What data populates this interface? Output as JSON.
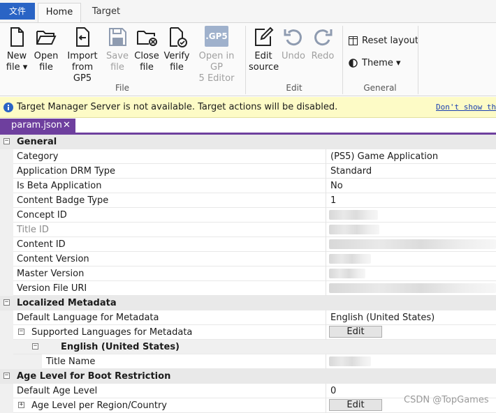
{
  "tabs": {
    "file": "文件",
    "home": "Home",
    "target": "Target"
  },
  "ribbon": {
    "file_group": "File",
    "edit_group": "Edit",
    "general_group": "General",
    "new_label": "New",
    "new_label2": "file ▾",
    "open_label": "Open",
    "open_label2": "file",
    "import_label": "Import",
    "import_label2": "from GP5",
    "save_label": "Save",
    "save_label2": "file",
    "close_label": "Close",
    "close_label2": "file",
    "verify_label": "Verify",
    "verify_label2": "file",
    "opengp_label": "Open in GP",
    "opengp_label2": "5 Editor",
    "gp5_badge": ".GP5",
    "editsrc_label": "Edit",
    "editsrc_label2": "source",
    "undo_label": "Undo",
    "redo_label": "Redo",
    "reset_layout": "Reset layout",
    "theme": "Theme ▾"
  },
  "infobar": {
    "message": "Target Manager Server is not available. Target actions will be disabled.",
    "dont_show": "Don't show this"
  },
  "doc_tab": {
    "name": "param.json",
    "close": "✕"
  },
  "grid": {
    "general": "General",
    "category": "Category",
    "category_val": "(PS5) Game Application",
    "drm": "Application DRM Type",
    "drm_val": "Standard",
    "beta": "Is Beta Application",
    "beta_val": "No",
    "badge": "Content Badge Type",
    "badge_val": "1",
    "concept": "Concept ID",
    "title_id": "Title ID",
    "content_id": "Content ID",
    "content_ver": "Content Version",
    "master_ver": "Master Version",
    "verfile": "Version File URI",
    "loc_meta": "Localized Metadata",
    "def_lang": "Default Language for Metadata",
    "def_lang_val": "English (United States)",
    "sup_lang": "Supported Languages for Metadata",
    "edit": "Edit",
    "eng": "English (United States)",
    "title_name": "Title Name",
    "age_cat": "Age Level for Boot Restriction",
    "def_age": "Default Age Level",
    "def_age_val": "0",
    "age_region": "Age Level per Region/Country"
  },
  "watermark": "CSDN @TopGames",
  "colors": {
    "accent": "#2a64c5",
    "doc_tab": "#6e3f9e",
    "info_bg": "#fdfbc6"
  }
}
